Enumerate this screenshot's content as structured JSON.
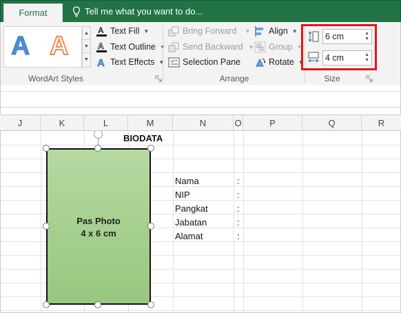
{
  "tabs": {
    "format_label": "Format",
    "tell_me": "Tell me what you want to do..."
  },
  "wordart": {
    "sample1": "A",
    "sample2": "A",
    "text_fill": "Text Fill",
    "text_outline": "Text Outline",
    "text_effects": "Text Effects",
    "group_label": "WordArt Styles"
  },
  "arrange": {
    "bring_forward": "Bring Forward",
    "send_backward": "Send Backward",
    "selection_pane": "Selection Pane",
    "align": "Align",
    "group": "Group",
    "rotate": "Rotate",
    "group_label": "Arrange"
  },
  "size": {
    "height_value": "6 cm",
    "width_value": "4 cm",
    "group_label": "Size"
  },
  "columns": [
    "J",
    "K",
    "L",
    "M",
    "N",
    "O",
    "P",
    "Q",
    "R"
  ],
  "sheet": {
    "title": "BIODATA",
    "fields": [
      {
        "label": "Nama",
        "colon": ":"
      },
      {
        "label": "NIP",
        "colon": ":"
      },
      {
        "label": "Pangkat",
        "colon": ":"
      },
      {
        "label": "Jabatan",
        "colon": ":"
      },
      {
        "label": "Alamat",
        "colon": ":"
      }
    ]
  },
  "shape": {
    "line1": "Pas Photo",
    "line2": "4 x 6 cm",
    "fill_top": "#b5d9a2",
    "fill_bottom": "#99c77e"
  },
  "colors": {
    "accent": "#217346",
    "highlight": "#e5131c"
  }
}
